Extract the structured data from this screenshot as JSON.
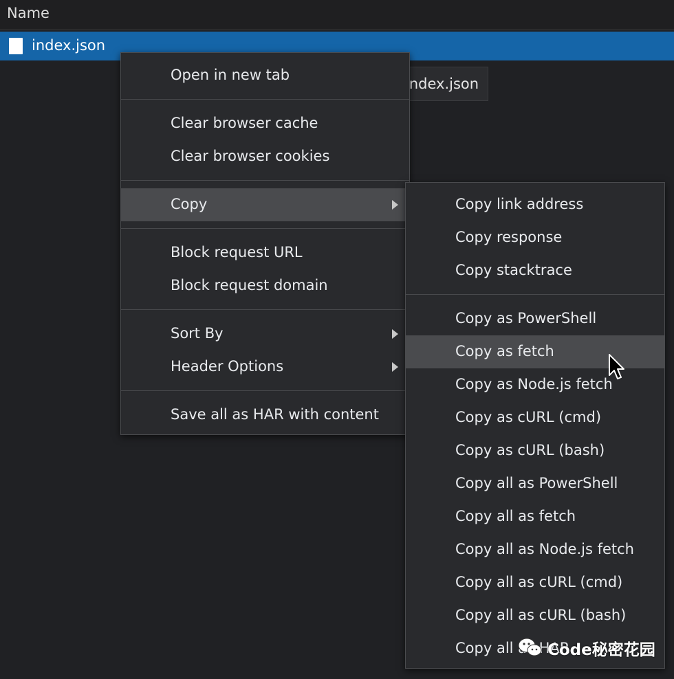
{
  "network_table": {
    "column_header": "Name",
    "selected_row": {
      "name": "index.json"
    },
    "tooltip_text": "index.json"
  },
  "context_menu": {
    "groups": [
      {
        "items": [
          {
            "label": "Open in new tab"
          }
        ]
      },
      {
        "items": [
          {
            "label": "Clear browser cache"
          },
          {
            "label": "Clear browser cookies"
          }
        ]
      },
      {
        "items": [
          {
            "label": "Copy",
            "has_submenu": true,
            "highlighted": true
          }
        ]
      },
      {
        "items": [
          {
            "label": "Block request URL"
          },
          {
            "label": "Block request domain"
          }
        ]
      },
      {
        "items": [
          {
            "label": "Sort By",
            "has_submenu": true
          },
          {
            "label": "Header Options",
            "has_submenu": true
          }
        ]
      },
      {
        "items": [
          {
            "label": "Save all as HAR with content"
          }
        ]
      }
    ]
  },
  "copy_submenu": {
    "groups": [
      {
        "items": [
          {
            "label": "Copy link address"
          },
          {
            "label": "Copy response"
          },
          {
            "label": "Copy stacktrace"
          }
        ]
      },
      {
        "items": [
          {
            "label": "Copy as PowerShell"
          },
          {
            "label": "Copy as fetch",
            "highlighted": true
          },
          {
            "label": "Copy as Node.js fetch"
          },
          {
            "label": "Copy as cURL (cmd)"
          },
          {
            "label": "Copy as cURL (bash)"
          },
          {
            "label": "Copy all as PowerShell"
          },
          {
            "label": "Copy all as fetch"
          },
          {
            "label": "Copy all as Node.js fetch"
          },
          {
            "label": "Copy all as cURL (cmd)"
          },
          {
            "label": "Copy all as cURL (bash)"
          },
          {
            "label": "Copy all as HAR"
          }
        ]
      }
    ]
  },
  "watermark": {
    "text": "Code秘密花园",
    "icon": "wechat-icon"
  },
  "colors": {
    "background": "#202124",
    "selection": "#1565a8",
    "menu_background": "#292a2d",
    "menu_highlight": "#4a4b4e"
  }
}
